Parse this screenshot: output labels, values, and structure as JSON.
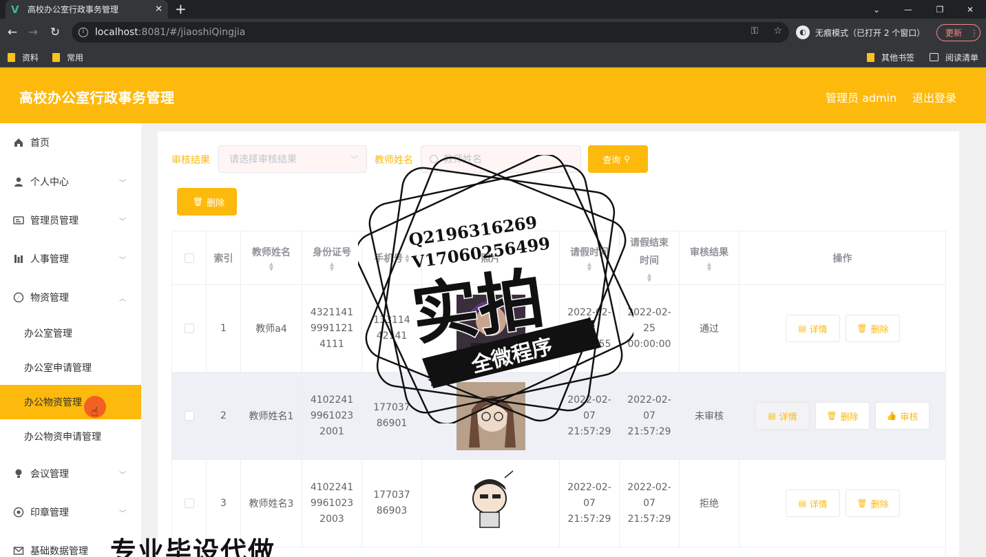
{
  "browser": {
    "tab_title": "高校办公室行政事务管理",
    "url_host": "localhost",
    "url_path": ":8081/#/jiaoshiQingjia",
    "incognito": "无痕模式（已打开 2 个窗口）",
    "update": "更新",
    "bookmarks": [
      "资料",
      "常用"
    ],
    "other_bookmarks": "其他书签",
    "reading_list": "阅读清单"
  },
  "header": {
    "title": "高校办公室行政事务管理",
    "admin": "管理员 admin",
    "logout": "退出登录"
  },
  "sidebar": {
    "items": [
      {
        "label": "首页",
        "icon": "home-icon"
      },
      {
        "label": "个人中心",
        "icon": "user-icon"
      },
      {
        "label": "管理员管理",
        "icon": "id-card-icon"
      },
      {
        "label": "人事管理",
        "icon": "chart-icon"
      },
      {
        "label": "物资管理",
        "icon": "compass-icon"
      },
      {
        "label": "会议管理",
        "icon": "bulb-icon"
      },
      {
        "label": "印章管理",
        "icon": "stamp-icon"
      },
      {
        "label": "基础数据管理",
        "icon": "mail-icon"
      }
    ],
    "subitems": [
      "办公室管理",
      "办公室申请管理",
      "办公物资管理",
      "办公物资申请管理"
    ]
  },
  "filters": {
    "result_label": "审核结果",
    "result_placeholder": "请选择审核结果",
    "name_label": "教师姓名",
    "name_placeholder": "教师姓名",
    "query": "查询",
    "delete": "删除"
  },
  "table": {
    "columns": [
      "索引",
      "教师姓名",
      "身份证号",
      "手机号",
      "照片",
      "请假时间",
      "请假结束时间",
      "审核结果",
      "操作"
    ],
    "rows": [
      {
        "index": "1",
        "name": "教师a4",
        "id": "432114199911214111",
        "phone": "13311442141",
        "start": "2022-02-08 15:48:55",
        "end": "2022-02-25 00:00:00",
        "result": "通过"
      },
      {
        "index": "2",
        "name": "教师姓名1",
        "id": "410224199610232001",
        "phone": "17703786901",
        "start": "2022-02-07 21:57:29",
        "end": "2022-02-07 21:57:29",
        "result": "未审核"
      },
      {
        "index": "3",
        "name": "教师姓名3",
        "id": "410224199610232003",
        "phone": "17703786903",
        "start": "2022-02-07 21:57:29",
        "end": "2022-02-07 21:57:29",
        "result": "拒绝"
      }
    ],
    "actions": {
      "detail": "详情",
      "delete": "删除",
      "audit": "审核"
    }
  },
  "watermark": {
    "contact_q": "Q2196316269",
    "contact_v": "V17060256499",
    "big": "实拍",
    "ribbon": "全微程序",
    "bottom": "专业毕设代做"
  },
  "colors": {
    "accent": "#fdb90c",
    "browser_dark": "#202124"
  }
}
